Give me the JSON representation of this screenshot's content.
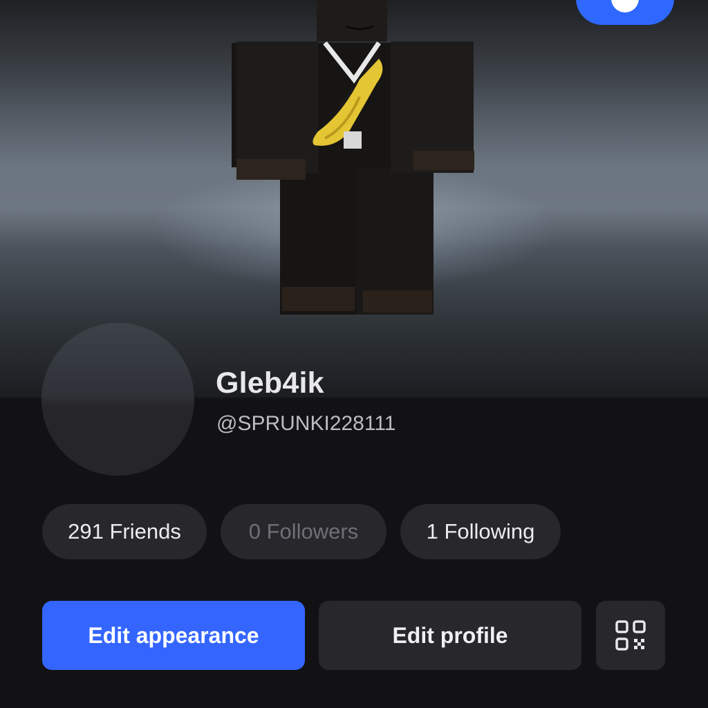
{
  "profile": {
    "display_name": "Gleb4ik",
    "username": "@SPRUNKI228111"
  },
  "stats": {
    "friends": "291 Friends",
    "followers": "0 Followers",
    "following": "1 Following"
  },
  "actions": {
    "edit_appearance": "Edit appearance",
    "edit_profile": "Edit profile",
    "qr_icon": "qr-code-icon"
  },
  "colors": {
    "primary": "#3466ff",
    "surface": "#27272c",
    "background": "#121215"
  }
}
